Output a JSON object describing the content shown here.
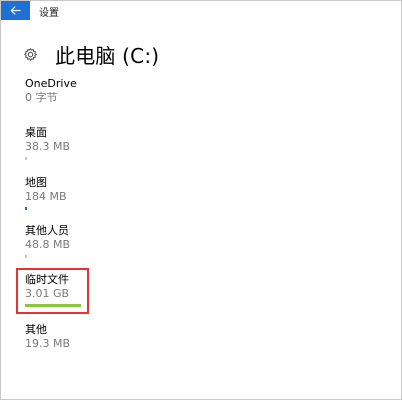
{
  "window": {
    "title": "设置"
  },
  "header": {
    "title": "此电脑 (C:)"
  },
  "items": [
    {
      "name": "OneDrive",
      "size": "0 字节",
      "fraction": 0.0,
      "bar_color": "#1e6fd6"
    },
    {
      "name": "桌面",
      "size": "38.3 MB",
      "fraction": 0.004,
      "bar_color": "#c8c8c8"
    },
    {
      "name": "地图",
      "size": "184 MB",
      "fraction": 0.03,
      "bar_color": "#1e6fd6"
    },
    {
      "name": "其他人员",
      "size": "48.8 MB",
      "fraction": 0.004,
      "bar_color": "#c8c8c8"
    },
    {
      "name": "临时文件",
      "size": "3.01 GB",
      "fraction": 1.0,
      "bar_color": "#8cc63f"
    },
    {
      "name": "其他",
      "size": "19.3 MB",
      "fraction": 0.0,
      "bar_color": "#c8c8c8"
    }
  ],
  "colors": {
    "accent": "#1e6fd6",
    "highlight_border": "#e53333"
  },
  "icons": {
    "back": "arrow-left-icon",
    "settings": "gear-icon"
  }
}
